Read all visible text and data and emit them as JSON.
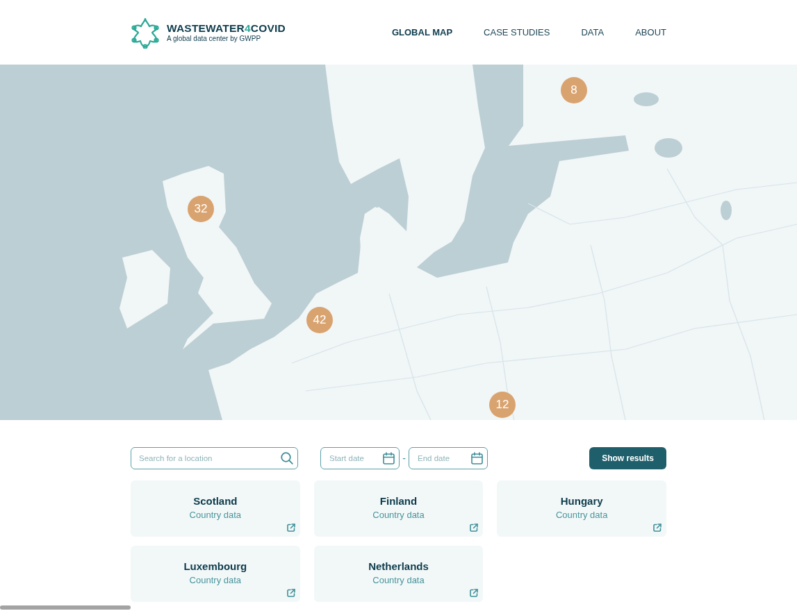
{
  "header": {
    "logo": {
      "parts": [
        {
          "text": "WASTEWATER",
          "accent": false
        },
        {
          "text": "4",
          "accent": true
        },
        {
          "text": "COVID",
          "accent": false
        }
      ],
      "tagline": "A global data center by GWPP"
    },
    "nav": [
      {
        "label": "GLOBAL MAP",
        "selected": true
      },
      {
        "label": "CASE STUDIES",
        "selected": false
      },
      {
        "label": "DATA",
        "selected": false
      },
      {
        "label": "ABOUT",
        "selected": false
      }
    ]
  },
  "map": {
    "clusters": [
      {
        "count": "8"
      },
      {
        "count": "32"
      },
      {
        "count": "42"
      },
      {
        "count": "12"
      }
    ]
  },
  "filters": {
    "search": {
      "placeholder": "Search for a location"
    },
    "start_date": {
      "placeholder": "Start date"
    },
    "separator": "-",
    "end_date": {
      "placeholder": "End date"
    },
    "submit": "Show results"
  },
  "results": [
    {
      "title": "Scotland",
      "subtitle": "Country data"
    },
    {
      "title": "Finland",
      "subtitle": "Country data"
    },
    {
      "title": "Hungary",
      "subtitle": "Country data"
    },
    {
      "title": "Luxembourg",
      "subtitle": "Country data"
    },
    {
      "title": "Netherlands",
      "subtitle": "Country data"
    }
  ]
}
